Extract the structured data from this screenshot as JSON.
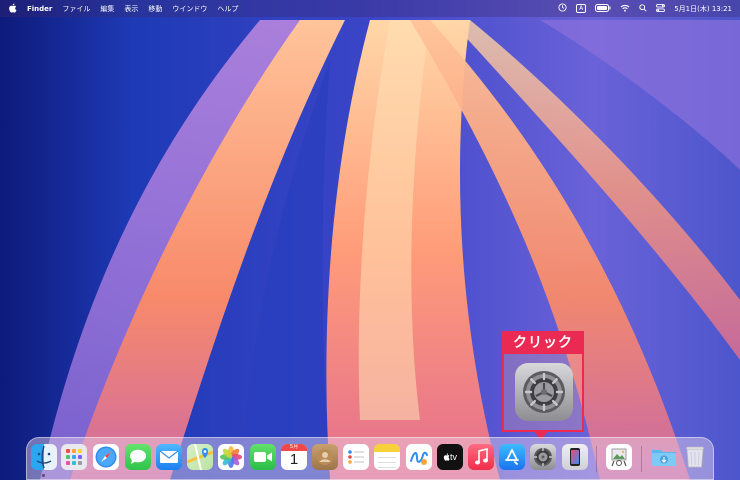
{
  "menubar": {
    "app_name": "Finder",
    "items": [
      "ファイル",
      "編集",
      "表示",
      "移動",
      "ウインドウ",
      "ヘルプ"
    ],
    "status_a": "A",
    "datetime": "5月1日(木) 13:21"
  },
  "callout": {
    "label": "クリック"
  },
  "dock": {
    "calendar_month": "5月",
    "calendar_day": "1",
    "tv_label": "tv",
    "items": [
      "finder-icon",
      "launchpad-icon",
      "safari-icon",
      "messages-icon",
      "mail-icon",
      "maps-icon",
      "photos-icon",
      "facetime-icon",
      "calendar-icon",
      "contacts-icon",
      "reminders-icon",
      "notes-icon",
      "freeform-icon",
      "apple-tv-icon",
      "music-icon",
      "app-store-icon",
      "system-settings-icon",
      "iphone-mirroring-icon",
      "preview-icon",
      "downloads-folder-icon",
      "trash-icon"
    ]
  },
  "colors": {
    "callout_red": "#ea2a52",
    "wallpaper_blue": "#1f3bb8",
    "wallpaper_orange": "#ff9a6a"
  }
}
